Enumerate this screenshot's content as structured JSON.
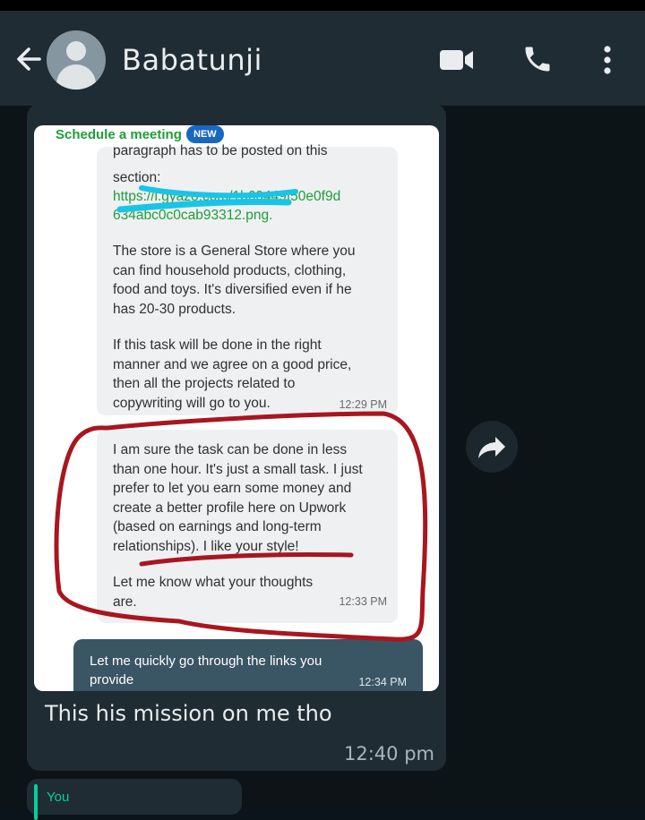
{
  "colors": {
    "header_bg": "#1f2c34",
    "bubble_in": "#202c33",
    "accent": "#06cf9c",
    "annotation_red": "#a8161f",
    "highlight_cyan": "#19c4e6"
  },
  "header": {
    "back_icon": "arrow-left-icon",
    "contact_name": "Babatunji",
    "icons": [
      "video-call-icon",
      "phone-icon",
      "more-vertical-icon"
    ]
  },
  "screenshot": {
    "schedule_label": "Schedule a meeting",
    "new_badge": "NEW",
    "message1": {
      "cut_line": "paragraph has to be posted on this",
      "section_text": "section:",
      "link_line1": "https://i.gyazo.com/1b60449f50e0f9d",
      "link_line2": "634abc0c0cab93312.png.",
      "para2": [
        "The store is a General Store where you",
        "can find household products, clothing,",
        "food and toys. It's diversified even if he",
        "has 20-30 products."
      ],
      "para3": [
        "If this task will be done in the right",
        "manner and we agree on a good price,",
        "then all the projects related to",
        "copywriting will go to you."
      ],
      "time": "12:29 PM"
    },
    "message2": {
      "para1": [
        "I am sure the task can be done in less",
        "than one hour. It's just a small task. I just",
        "prefer to let you earn some money and",
        "create a better profile here on Upwork",
        "(based on earnings and long-term",
        "relationships). I like your style!"
      ],
      "para2": [
        "Let me know what your thoughts",
        "are."
      ],
      "time": "12:33 PM"
    },
    "reply": {
      "lines": [
        "Let me quickly go through the links you",
        "provide"
      ],
      "time": "12:34 PM"
    }
  },
  "caption": "This his mission on me tho",
  "caption_time": "12:40 pm",
  "forward_icon": "forward-icon",
  "next_bubble_sender": "You"
}
